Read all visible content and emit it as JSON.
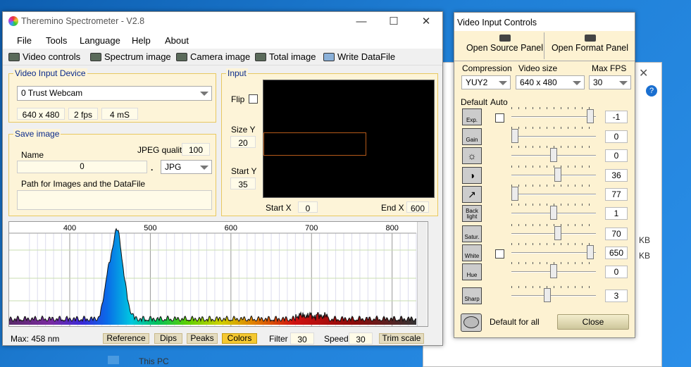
{
  "main": {
    "title": "Theremino Spectrometer - V2.8",
    "menu": [
      "File",
      "Tools",
      "Language",
      "Help",
      "About"
    ],
    "toolbar": [
      "Video controls",
      "Spectrum image",
      "Camera image",
      "Total image",
      "Write DataFile"
    ],
    "video_input": {
      "legend": "Video Input Device",
      "device": "0 Trust Webcam",
      "resolution": "640 x 480",
      "fps": "2 fps",
      "ms": "4 mS"
    },
    "save": {
      "legend": "Save image",
      "name_label": "Name",
      "jpeg_label": "JPEG quality",
      "jpeg_value": "100",
      "name_value": "0",
      "dot": ".",
      "format": "JPG",
      "path_label": "Path for Images and the DataFile",
      "path_value": ""
    },
    "input": {
      "legend": "Input",
      "flip": "Flip",
      "sizey_label": "Size Y",
      "sizey": "20",
      "starty_label": "Start Y",
      "starty": "35",
      "startx_label": "Start X",
      "startx": "0",
      "endx_label": "End X",
      "endx": "600"
    },
    "spectrum": {
      "ticks": [
        "400",
        "500",
        "600",
        "700",
        "800"
      ],
      "peak_nm": 458,
      "peak_intensity": 0.98
    },
    "bottom": {
      "max": "Max: 458 nm",
      "reference": "Reference",
      "dips": "Dips",
      "peaks": "Peaks",
      "colors": "Colors",
      "filter_label": "Filter",
      "filter": "30",
      "speed_label": "Speed",
      "speed": "30",
      "trim": "Trim scale"
    }
  },
  "vc": {
    "title": "Video Input Controls",
    "source": "Open Source Panel",
    "format": "Open Format Panel",
    "compression_label": "Compression",
    "compression": "YUY2",
    "size_label": "Video size",
    "size": "640 x 480",
    "fps_label": "Max FPS",
    "fps": "30",
    "default_label": "Default",
    "auto_label": "Auto",
    "controls": [
      {
        "name": "Exp.",
        "value": "-1",
        "pos": 0.97
      },
      {
        "name": "Gain",
        "value": "0",
        "pos": 0.0
      },
      {
        "name": "",
        "value": "0",
        "pos": 0.5
      },
      {
        "name": "",
        "value": "36",
        "pos": 0.55
      },
      {
        "name": "",
        "value": "77",
        "pos": 0.0
      },
      {
        "name": "Back light",
        "value": "1",
        "pos": 0.5
      },
      {
        "name": "Satur.",
        "value": "70",
        "pos": 0.55
      },
      {
        "name": "White",
        "value": "650",
        "pos": 0.97
      },
      {
        "name": "Hue",
        "value": "0",
        "pos": 0.5
      },
      {
        "name": "Sharp",
        "value": "3",
        "pos": 0.42
      }
    ],
    "default_all": "Default for all",
    "close": "Close"
  },
  "background": {
    "this_pc": "This PC",
    "kb1": "KB",
    "kb2": "KB"
  },
  "colors": {
    "panel_border": "#e8c860",
    "legend": "#0a2a8a",
    "colors_btn": "#f5c830"
  }
}
